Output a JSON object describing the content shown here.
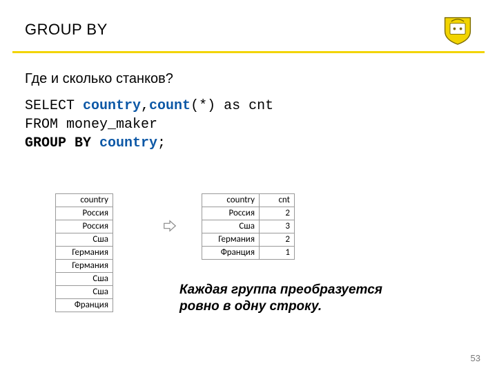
{
  "header": {
    "title": "GROUP BY"
  },
  "question": "Где и сколько станков?",
  "sql": {
    "select": "SELECT ",
    "col1": "country",
    "comma": ",",
    "col2": "count",
    "col2_tail": "(*) as cnt",
    "from": "FROM money_maker",
    "groupby_kw": "GROUP BY ",
    "groupby_col": "country",
    "semicolon": ";"
  },
  "table1": {
    "header": "country",
    "rows": [
      "Россия",
      "Россия",
      "Сша",
      "Германия",
      "Германия",
      "Сша",
      "Сша",
      "Франция"
    ]
  },
  "table2": {
    "h1": "country",
    "h2": "cnt",
    "rows": [
      {
        "c": "Россия",
        "n": "2"
      },
      {
        "c": "Сша",
        "n": "3"
      },
      {
        "c": "Германия",
        "n": "2"
      },
      {
        "c": "Франция",
        "n": "1"
      }
    ]
  },
  "caption": "Каждая группа преобразуется ровно в одну строку.",
  "page": "53"
}
